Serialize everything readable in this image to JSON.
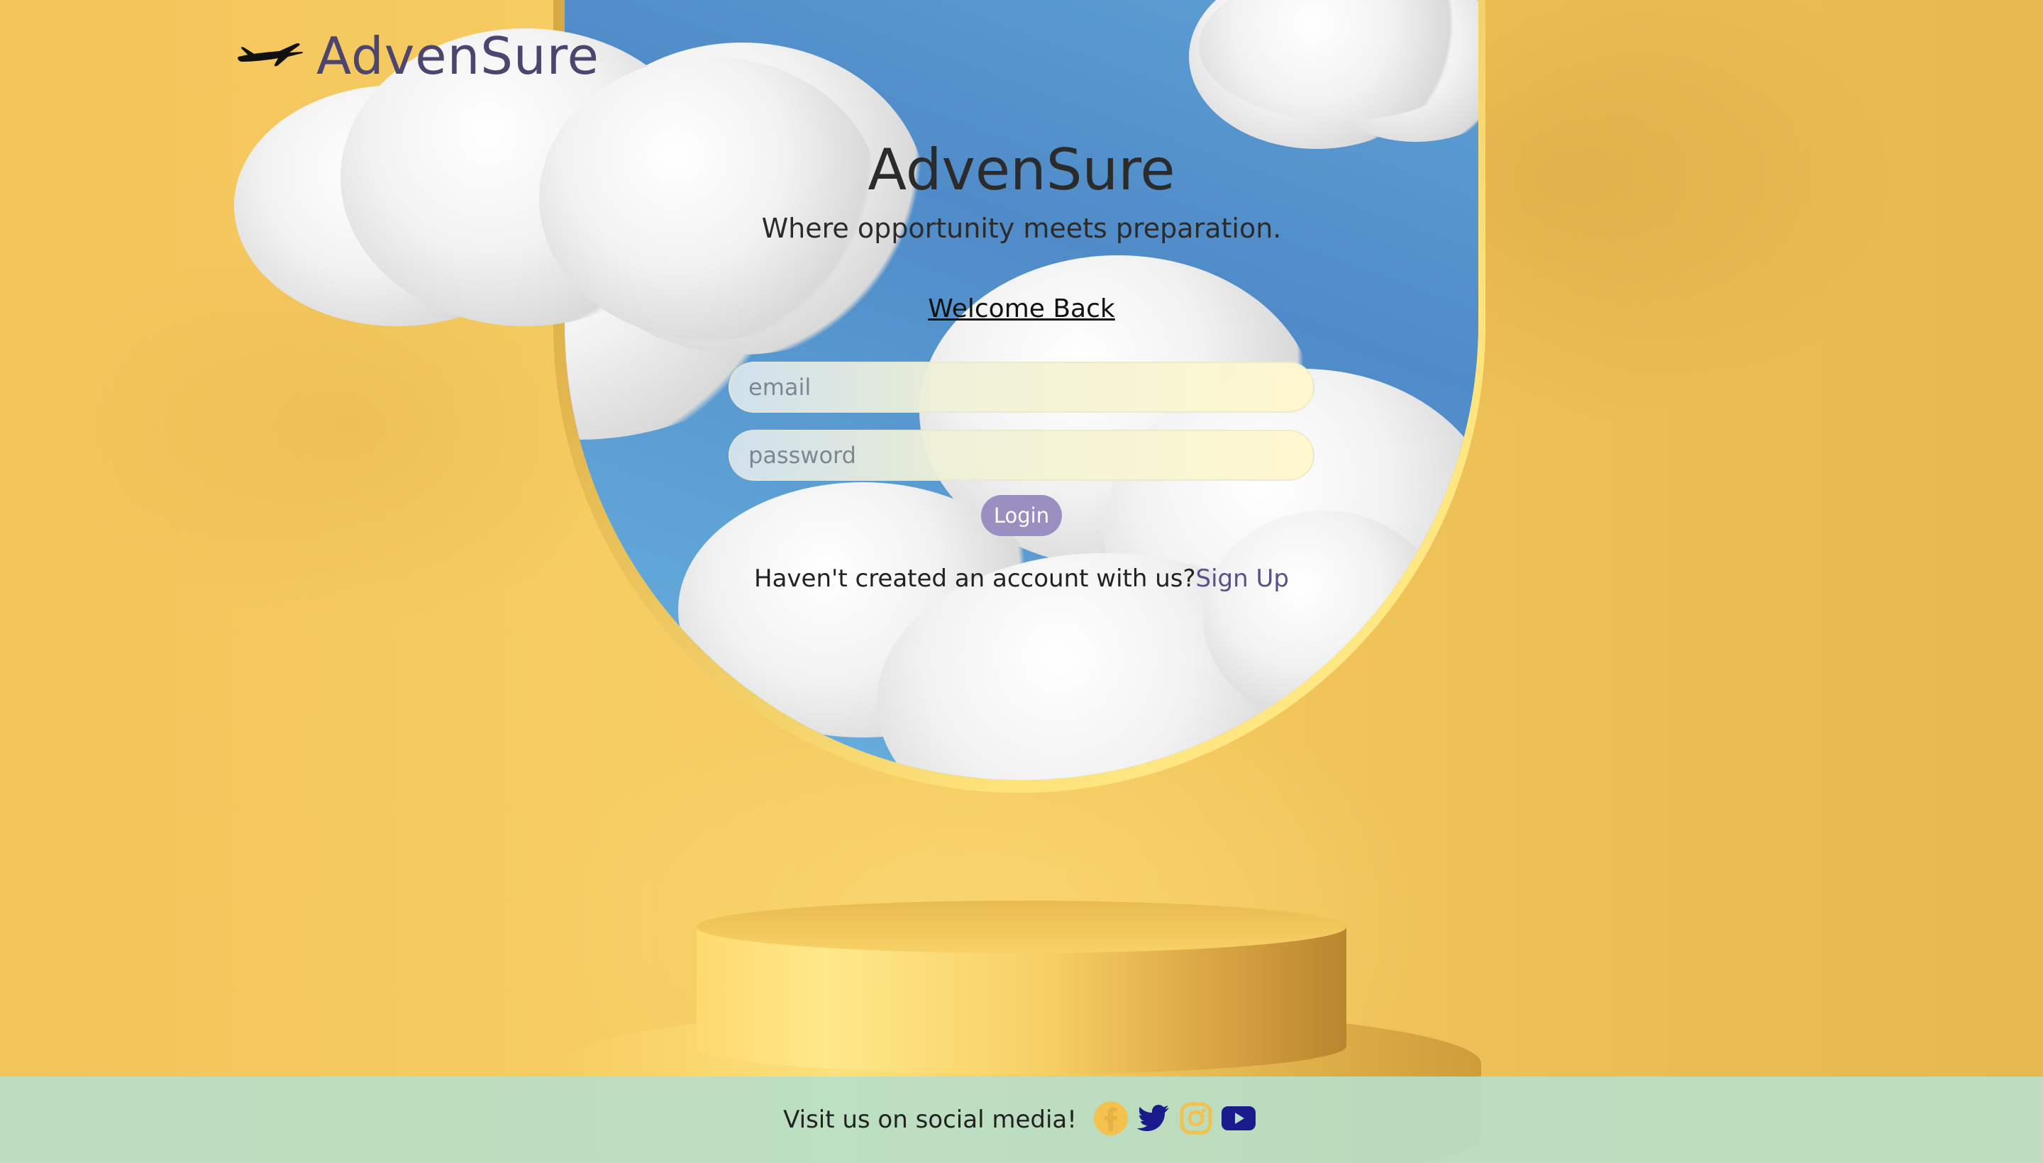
{
  "header": {
    "brand": "AdvenSure"
  },
  "hero": {
    "title": "AdvenSure",
    "tagline": "Where opportunity meets preparation."
  },
  "login_form": {
    "heading": "Welcome Back",
    "email_placeholder": "email",
    "password_placeholder": "password",
    "login_label": "Login",
    "signup_prompt": "Haven't created an account with us?",
    "signup_link": "Sign Up"
  },
  "footer": {
    "text": "Visit us on social media!",
    "social": [
      {
        "icon": "facebook-icon",
        "color": "#f2c14e"
      },
      {
        "icon": "twitter-icon",
        "color": "#1a1a8c"
      },
      {
        "icon": "instagram-icon",
        "color": "#f2c14e"
      },
      {
        "icon": "youtube-icon",
        "color": "#1a1a8c"
      }
    ]
  },
  "colors": {
    "brand": "#4d4470",
    "button": "#9a8fc0",
    "link": "#5a4f8a",
    "footer_bg": "#b7dec8"
  }
}
